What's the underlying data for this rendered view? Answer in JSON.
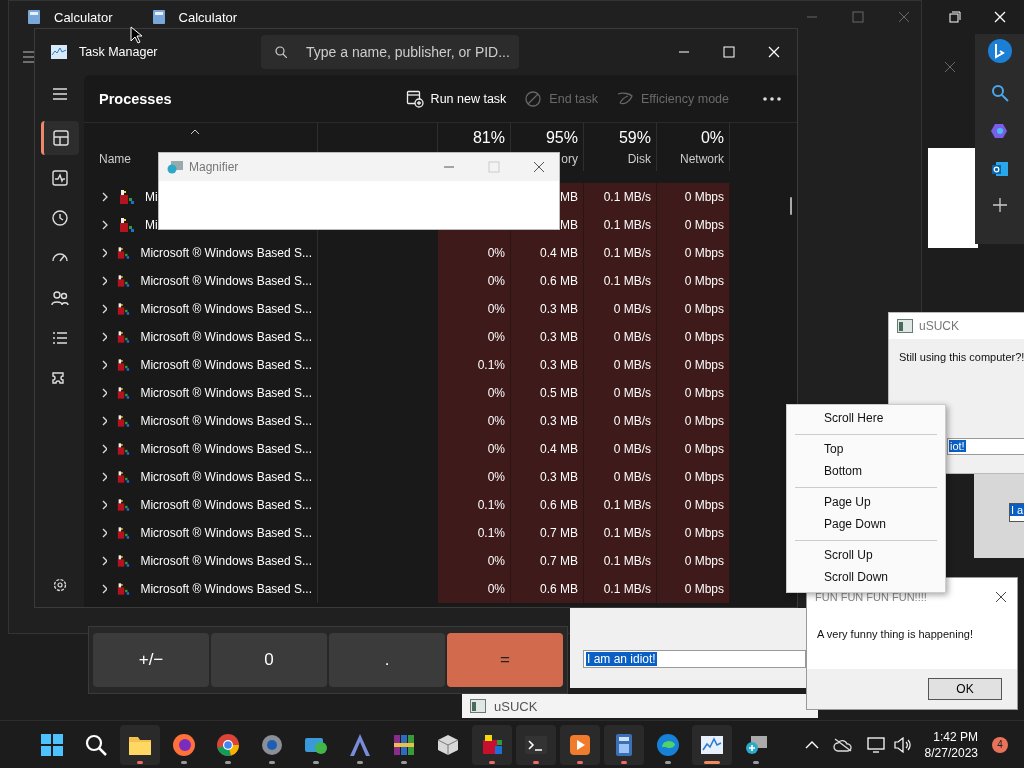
{
  "calculator_windows": [
    {
      "title": "Calculator"
    },
    {
      "title": "Calculator"
    }
  ],
  "calculator_keys": [
    {
      "label": "+/−",
      "kind": "number"
    },
    {
      "label": "0",
      "kind": "number"
    },
    {
      "label": ".",
      "kind": "number"
    },
    {
      "label": "=",
      "kind": "accent"
    }
  ],
  "task_manager": {
    "title": "Task Manager",
    "search": {
      "placeholder": "Type a name, publisher, or PID..."
    },
    "nav": [
      {
        "selected": false
      },
      {
        "selected": true
      },
      {
        "selected": false
      },
      {
        "selected": false
      },
      {
        "selected": false
      },
      {
        "selected": false
      },
      {
        "selected": false
      },
      {
        "selected": false
      }
    ],
    "page_title": "Processes",
    "actions": [
      {
        "label": "Run new task",
        "disabled": false
      },
      {
        "label": "End task",
        "disabled": true
      },
      {
        "label": "Efficiency mode",
        "disabled": true
      }
    ],
    "columns": [
      {
        "label": "Name"
      },
      {
        "percent": "81%"
      },
      {
        "percent": "95%",
        "label": "ory"
      },
      {
        "percent": "59%",
        "label": "Disk"
      },
      {
        "percent": "0%",
        "label": "Network"
      }
    ],
    "rows": [
      {
        "name": "Mi",
        "memory": "MB",
        "disk": "0.1 MB/s",
        "network": "0 Mbps"
      },
      {
        "name": "Mi",
        "memory": "MB",
        "disk": "0.1 MB/s",
        "network": "0 Mbps"
      },
      {
        "name": "Microsoft ® Windows Based S...",
        "cpu": "0%",
        "memory": "0.4 MB",
        "disk": "0.1 MB/s",
        "network": "0 Mbps"
      },
      {
        "name": "Microsoft ® Windows Based S...",
        "cpu": "0%",
        "memory": "0.6 MB",
        "disk": "0.1 MB/s",
        "network": "0 Mbps"
      },
      {
        "name": "Microsoft ® Windows Based S...",
        "cpu": "0%",
        "memory": "0.3 MB",
        "disk": "0 MB/s",
        "network": "0 Mbps"
      },
      {
        "name": "Microsoft ® Windows Based S...",
        "cpu": "0%",
        "memory": "0.3 MB",
        "disk": "0 MB/s",
        "network": "0 Mbps"
      },
      {
        "name": "Microsoft ® Windows Based S...",
        "cpu": "0.1%",
        "memory": "0.3 MB",
        "disk": "0 MB/s",
        "network": "0 Mbps"
      },
      {
        "name": "Microsoft ® Windows Based S...",
        "cpu": "0%",
        "memory": "0.5 MB",
        "disk": "0 MB/s",
        "network": "0 Mbps"
      },
      {
        "name": "Microsoft ® Windows Based S...",
        "cpu": "0%",
        "memory": "0.3 MB",
        "disk": "0 MB/s",
        "network": "0 Mbps"
      },
      {
        "name": "Microsoft ® Windows Based S...",
        "cpu": "0%",
        "memory": "0.4 MB",
        "disk": "0 MB/s",
        "network": "0 Mbps"
      },
      {
        "name": "Microsoft ® Windows Based S...",
        "cpu": "0%",
        "memory": "0.3 MB",
        "disk": "0 MB/s",
        "network": "0 Mbps"
      },
      {
        "name": "Microsoft ® Windows Based S...",
        "cpu": "0.1%",
        "memory": "0.6 MB",
        "disk": "0.1 MB/s",
        "network": "0 Mbps"
      },
      {
        "name": "Microsoft ® Windows Based S...",
        "cpu": "0.1%",
        "memory": "0.7 MB",
        "disk": "0.1 MB/s",
        "network": "0 Mbps"
      },
      {
        "name": "Microsoft ® Windows Based S...",
        "cpu": "0%",
        "memory": "0.7 MB",
        "disk": "0.1 MB/s",
        "network": "0 Mbps"
      },
      {
        "name": "Microsoft ® Windows Based S...",
        "cpu": "0%",
        "memory": "0.6 MB",
        "disk": "0.1 MB/s",
        "network": "0 Mbps"
      }
    ]
  },
  "magnifier": {
    "title": "Magnifier"
  },
  "usuck_dialog": {
    "title": "uSUCK",
    "message": "Still using this computer?!",
    "field": "iot!"
  },
  "side_field": {
    "value": "I a"
  },
  "context_menu": {
    "groups": [
      [
        "Scroll Here"
      ],
      [
        "Top",
        "Bottom"
      ],
      [
        "Page Up",
        "Page Down"
      ],
      [
        "Scroll Up",
        "Scroll Down"
      ]
    ]
  },
  "fun_dialog": {
    "title": "FUN FUN FUN FUN!!!!",
    "message": "A very funny thing is happening!",
    "button": "OK"
  },
  "idiot_field": {
    "value": "I am an idiot!"
  },
  "usuck_bar": {
    "title": "uSUCK"
  },
  "taskbar": {
    "apps": [
      {
        "running": false,
        "attention": false,
        "selected": false
      },
      {
        "running": false,
        "attention": false,
        "selected": false
      },
      {
        "running": true,
        "attention": true,
        "selected": false
      },
      {
        "running": true,
        "attention": false,
        "selected": false
      },
      {
        "running": true,
        "attention": false,
        "selected": false
      },
      {
        "running": true,
        "attention": false,
        "selected": false
      },
      {
        "running": true,
        "attention": false,
        "selected": false
      },
      {
        "running": true,
        "attention": false,
        "selected": false
      },
      {
        "running": true,
        "attention": false,
        "selected": false
      },
      {
        "running": false,
        "attention": false,
        "selected": false
      },
      {
        "running": true,
        "attention": true,
        "selected": false
      },
      {
        "running": true,
        "attention": true,
        "selected": false
      },
      {
        "running": true,
        "attention": true,
        "selected": false
      },
      {
        "running": true,
        "attention": true,
        "selected": false
      },
      {
        "running": true,
        "attention": false,
        "selected": false
      },
      {
        "running": true,
        "attention": false,
        "selected": true
      },
      {
        "running": true,
        "attention": false,
        "selected": false
      }
    ],
    "time": "1:42 PM",
    "date": "8/27/2023",
    "badge": "4"
  }
}
